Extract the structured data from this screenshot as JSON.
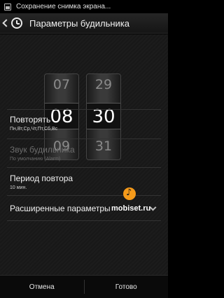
{
  "status_bar": {
    "notification_text": "Сохранение снимка экрана..."
  },
  "action_bar": {
    "title": "Параметры будильника"
  },
  "time_picker": {
    "hours": {
      "prev": "07",
      "current": "08",
      "next": "09"
    },
    "minutes": {
      "prev": "29",
      "current": "30",
      "next": "31"
    }
  },
  "settings": {
    "repeat": {
      "title": "Повторять",
      "value": "Пн,Вт,Ср,Чт,Пт,Сб,Вс"
    },
    "sound": {
      "title": "Звук будильника",
      "value": "По умолчанию (Alarm)"
    },
    "snooze": {
      "title": "Период повтора",
      "value": "10 мин."
    },
    "advanced": {
      "title": "Расширенные параметры"
    }
  },
  "watermark": {
    "text": "mobiset.ru"
  },
  "bottom_bar": {
    "cancel_label": "Отмена",
    "done_label": "Готово"
  }
}
